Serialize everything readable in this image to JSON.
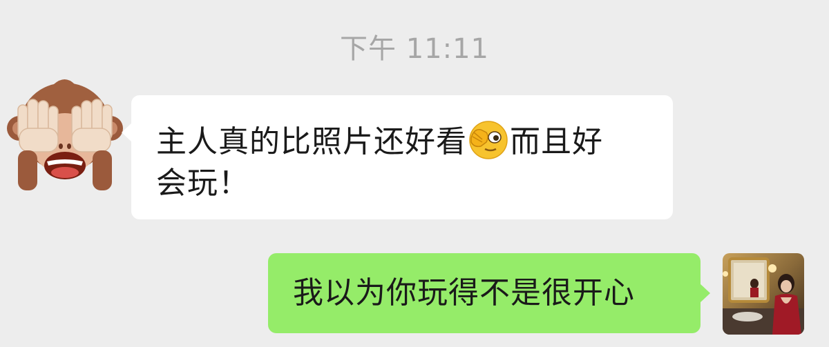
{
  "chat": {
    "timestamp": "下午 11:11",
    "messages": [
      {
        "sender": "other",
        "avatar_icon": "see-no-evil-monkey-icon",
        "text_before_emoji": "主人真的比照片还好看",
        "emoji": "hand-over-eye-face-icon",
        "text_after_emoji": "而且好",
        "text_line2": "会玩！"
      },
      {
        "sender": "self",
        "avatar_icon": "user-photo-avatar",
        "text": "我以为你玩得不是很开心"
      }
    ]
  },
  "colors": {
    "background": "#ededed",
    "incoming_bubble": "#ffffff",
    "outgoing_bubble": "#95ec69",
    "timestamp_text": "#a6a6a6"
  }
}
